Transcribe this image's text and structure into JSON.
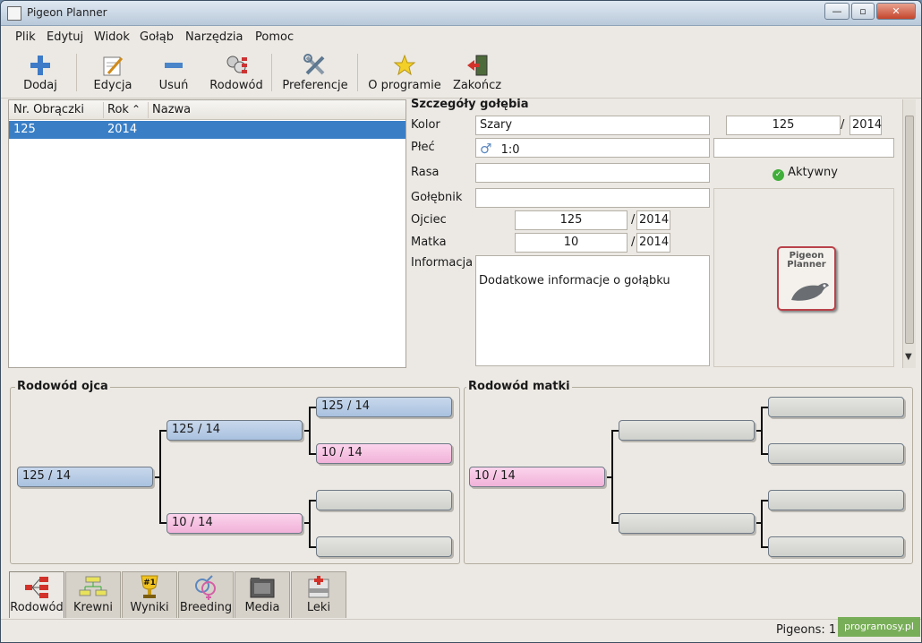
{
  "window": {
    "title": "Pigeon Planner",
    "minimize": "—",
    "restore": "▫",
    "close": "✕"
  },
  "menu": [
    {
      "label": "Plik"
    },
    {
      "label": "Edytuj"
    },
    {
      "label": "Widok"
    },
    {
      "label": "Gołąb"
    },
    {
      "label": "Narzędzia"
    },
    {
      "label": "Pomoc"
    }
  ],
  "toolbar": {
    "add": "Dodaj",
    "edit": "Edycja",
    "remove": "Usuń",
    "pedigree": "Rodowód",
    "preferences": "Preferencje",
    "about": "O programie",
    "quit": "Zakończ"
  },
  "list": {
    "columns": [
      "Nr. Obrączki",
      "Rok",
      "Nazwa"
    ],
    "sort_indicator": "⌃",
    "rows": [
      {
        "ring": "125",
        "year": "2014",
        "name": ""
      }
    ]
  },
  "details": {
    "title": "Szczegóły gołębia",
    "color_label": "Kolor",
    "color_value": "Szary",
    "ring_value": "125",
    "ring_year": "2014",
    "sex_label": "Płeć",
    "sex_symbol": "♂",
    "sex_value": "1:0",
    "sex_extra": "",
    "breed_label": "Rasa",
    "breed_value": "",
    "active_label": "Aktywny",
    "loft_label": "Gołębnik",
    "loft_value": "",
    "sire_label": "Ojciec",
    "sire_ring": "125",
    "sire_year": "2014",
    "dam_label": "Matka",
    "dam_ring": "10",
    "dam_year": "2014",
    "info_label": "Informacja",
    "info_value": "Dodatkowe informacje o gołąbku",
    "logo_text_1": "Pigeon",
    "logo_text_2": "Planner",
    "slash": "/"
  },
  "pedigree_sire": {
    "title": "Rodowód ojca",
    "gen0": "125 / 14",
    "gen1_sire": "125 / 14",
    "gen1_dam": "10 / 14",
    "gen2_a": "125 / 14",
    "gen2_b": "10 / 14",
    "gen2_c": "",
    "gen2_d": ""
  },
  "pedigree_dam": {
    "title": "Rodowód matki",
    "gen0": "10 / 14",
    "gen1_sire": "",
    "gen1_dam": "",
    "gen2_a": "",
    "gen2_b": "",
    "gen2_c": "",
    "gen2_d": ""
  },
  "tabs": [
    {
      "label": "Rodowód"
    },
    {
      "label": "Krewni"
    },
    {
      "label": "Wyniki",
      "badge": "#1"
    },
    {
      "label": "Breeding"
    },
    {
      "label": "Media"
    },
    {
      "label": "Leki"
    }
  ],
  "status": {
    "count": "Pigeons: 1"
  },
  "watermark": "programosy.pl",
  "colors": {
    "selection": "#3a7fc6",
    "male_box": "#b4cae4",
    "female_box": "#f5c2e2",
    "empty_box": "#d9dad6"
  }
}
